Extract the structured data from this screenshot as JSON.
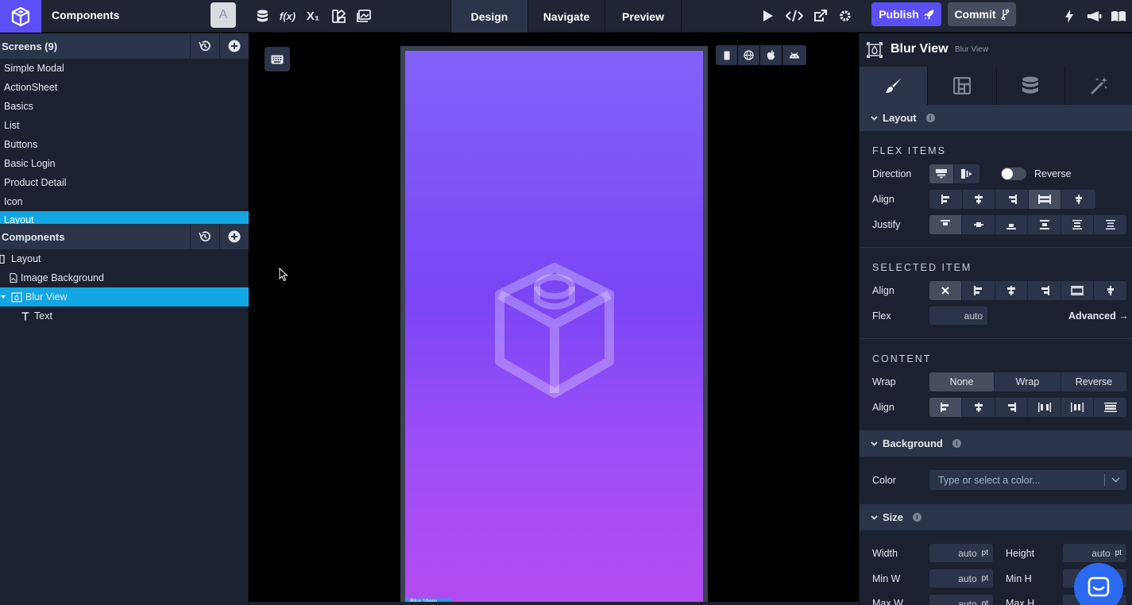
{
  "app": {
    "title": "Components",
    "avatar_letter": "A"
  },
  "topbar": {
    "icons": [
      "database-icon",
      "function-icon",
      "subscript-icon",
      "palette-icon",
      "image-icon"
    ],
    "function_glyph": "f(x)",
    "subscript_glyph": "X₁",
    "tabs": [
      {
        "label": "Design",
        "active": true
      },
      {
        "label": "Navigate",
        "active": false
      },
      {
        "label": "Preview",
        "active": false
      }
    ],
    "publish_label": "Publish",
    "commit_label": "Commit",
    "colors": {
      "brand": "#5b4ff5",
      "selected": "#12a6e4"
    }
  },
  "sidebar": {
    "screens_title": "Screens (9)",
    "screens": [
      "Simple Modal",
      "ActionSheet",
      "Basics",
      "List",
      "Buttons",
      "Basic Login",
      "Product Detail",
      "Icon",
      "Layout"
    ],
    "selected_screen": "Layout",
    "components_title": "Components",
    "tree": [
      {
        "label": "Layout",
        "depth": 0
      },
      {
        "label": "Image Background",
        "depth": 1
      },
      {
        "label": "Blur View",
        "depth": 1,
        "selected": true
      },
      {
        "label": "Text",
        "depth": 2
      }
    ]
  },
  "canvas": {
    "selected_tag": "Blur View"
  },
  "panel": {
    "title": "Blur View",
    "subtitle": "Blur View",
    "sections": {
      "layout": "Layout",
      "background": "Background",
      "size": "Size"
    },
    "flex_items": {
      "caption": "FLEX ITEMS",
      "direction_label": "Direction",
      "reverse_label": "Reverse",
      "align_label": "Align",
      "justify_label": "Justify"
    },
    "selected_item": {
      "caption": "SELECTED ITEM",
      "align_label": "Align",
      "flex_label": "Flex",
      "flex_value": "auto",
      "advanced_label": "Advanced →"
    },
    "content": {
      "caption": "CONTENT",
      "wrap_label": "Wrap",
      "wrap_options": [
        "None",
        "Wrap",
        "Reverse"
      ],
      "wrap_selected": "None",
      "align_label": "Align"
    },
    "background": {
      "color_label": "Color",
      "color_placeholder": "Type or select a color..."
    },
    "size": {
      "width_label": "Width",
      "width_value": "auto",
      "height_label": "Height",
      "height_value": "auto",
      "min_w_label": "Min W",
      "min_w_value": "auto",
      "min_h_label": "Min H",
      "max_w_label": "Max W",
      "max_w_value": "auto",
      "max_h_label": "Max H",
      "unit": "pt"
    }
  }
}
